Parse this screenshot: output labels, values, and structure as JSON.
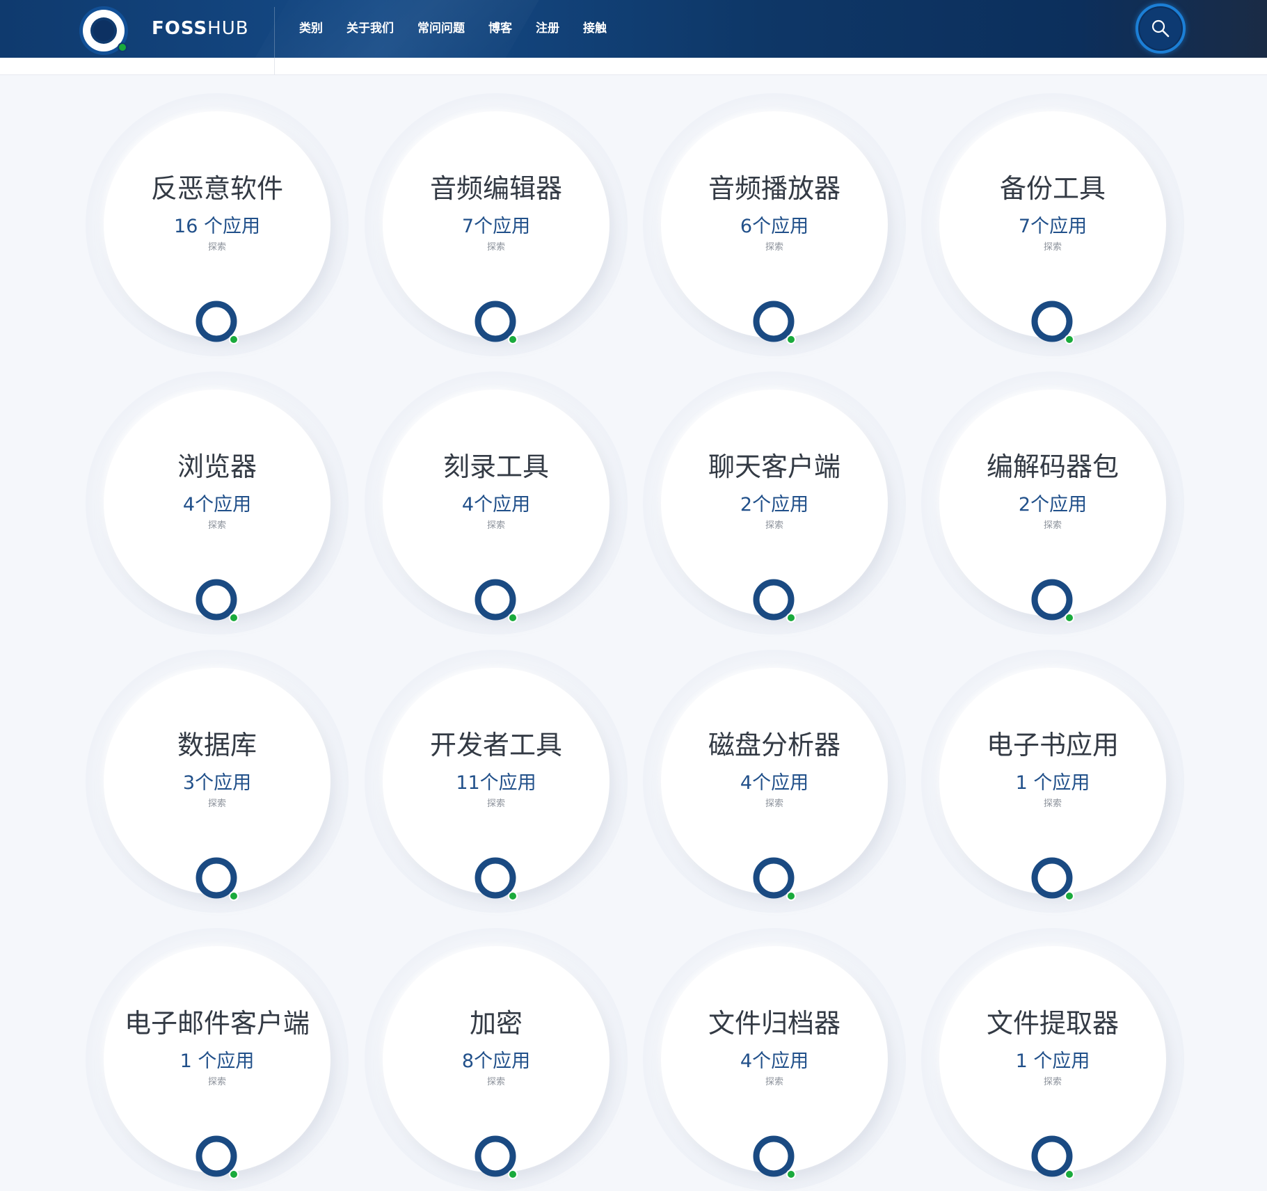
{
  "header": {
    "brand_bold": "FOSS",
    "brand_light": "HUB",
    "nav": [
      "类别",
      "关于我们",
      "常问问题",
      "博客",
      "注册",
      "接触"
    ],
    "search_icon": "search-icon"
  },
  "colors": {
    "header_bg": "#0f3a6e",
    "accent_blue": "#1a4a82",
    "accent_green": "#1aaa3c",
    "count_text": "#21508a"
  },
  "categories": [
    {
      "title": "反恶意软件",
      "count": "16 个应用",
      "explore": "探索"
    },
    {
      "title": "音频编辑器",
      "count": "7个应用",
      "explore": "探索"
    },
    {
      "title": "音频播放器",
      "count": "6个应用",
      "explore": "探索"
    },
    {
      "title": "备份工具",
      "count": "7个应用",
      "explore": "探索"
    },
    {
      "title": "浏览器",
      "count": "4个应用",
      "explore": "探索"
    },
    {
      "title": "刻录工具",
      "count": "4个应用",
      "explore": "探索"
    },
    {
      "title": "聊天客户端",
      "count": "2个应用",
      "explore": "探索"
    },
    {
      "title": "编解码器包",
      "count": "2个应用",
      "explore": "探索"
    },
    {
      "title": "数据库",
      "count": "3个应用",
      "explore": "探索"
    },
    {
      "title": "开发者工具",
      "count": "11个应用",
      "explore": "探索"
    },
    {
      "title": "磁盘分析器",
      "count": "4个应用",
      "explore": "探索"
    },
    {
      "title": "电子书应用",
      "count": "1 个应用",
      "explore": "探索"
    },
    {
      "title": "电子邮件客户端",
      "count": "1 个应用",
      "explore": "探索"
    },
    {
      "title": "加密",
      "count": "8个应用",
      "explore": "探索"
    },
    {
      "title": "文件归档器",
      "count": "4个应用",
      "explore": "探索"
    },
    {
      "title": "文件提取器",
      "count": "1 个应用",
      "explore": "探索"
    }
  ]
}
